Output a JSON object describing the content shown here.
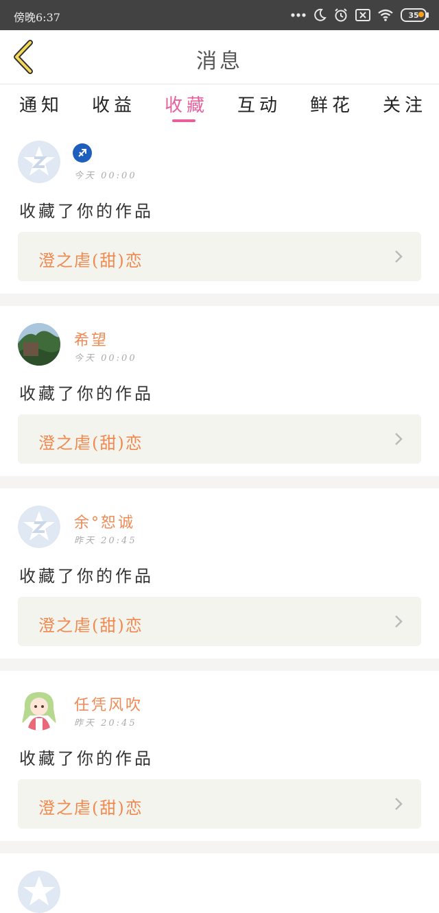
{
  "status_bar": {
    "time": "傍晚6:37",
    "battery": "35"
  },
  "header": {
    "title": "消息"
  },
  "tabs": [
    {
      "label": "通知",
      "active": false
    },
    {
      "label": "收益",
      "active": false
    },
    {
      "label": "收藏",
      "active": true
    },
    {
      "label": "互动",
      "active": false
    },
    {
      "label": "鲜花",
      "active": false
    },
    {
      "label": "关注",
      "active": false
    }
  ],
  "messages": [
    {
      "username": "",
      "time": "今天 00:00",
      "action": "收藏了你的作品",
      "work_title": "澄之虐(甜)恋",
      "avatar": "default-qq-avatar",
      "badge": "sagittarius-icon"
    },
    {
      "username": "希望",
      "time": "今天 00:00",
      "action": "收藏了你的作品",
      "work_title": "澄之虐(甜)恋",
      "avatar": "landscape-photo-avatar"
    },
    {
      "username": "余°恕诚",
      "time": "昨天 20:45",
      "action": "收藏了你的作品",
      "work_title": "澄之虐(甜)恋",
      "avatar": "default-qq-avatar"
    },
    {
      "username": "任凭风吹",
      "time": "昨天 20:45",
      "action": "收藏了你的作品",
      "work_title": "澄之虐(甜)恋",
      "avatar": "anime-girl-avatar"
    }
  ],
  "colors": {
    "accent": "#e8609b",
    "username": "#f08a55",
    "work_box": "#f4f4ee"
  }
}
